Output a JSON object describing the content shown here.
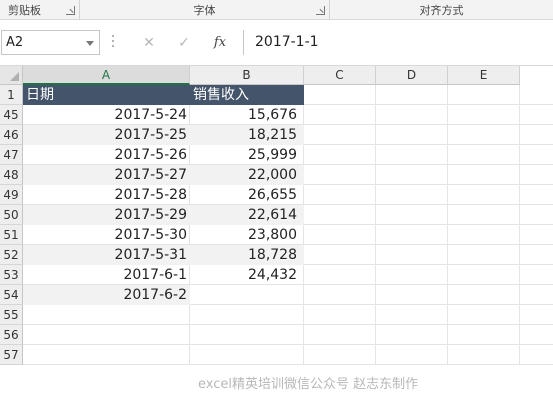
{
  "ribbon": {
    "groups": [
      {
        "label": "剪贴板"
      },
      {
        "label": "字体"
      },
      {
        "label": "对齐方式"
      }
    ]
  },
  "formula_bar": {
    "name_box": "A2",
    "cancel_glyph": "✕",
    "enter_glyph": "✓",
    "fx_label": "fx",
    "value": "2017-1-1"
  },
  "sheet": {
    "columns": [
      "A",
      "B",
      "C",
      "D",
      "E"
    ],
    "header_row": {
      "row": "1",
      "a": "日期",
      "b": "销售收入"
    },
    "rows": [
      {
        "row": "45",
        "a": "2017-5-24",
        "b": "15,676"
      },
      {
        "row": "46",
        "a": "2017-5-25",
        "b": "18,215"
      },
      {
        "row": "47",
        "a": "2017-5-26",
        "b": "25,999"
      },
      {
        "row": "48",
        "a": "2017-5-27",
        "b": "22,000"
      },
      {
        "row": "49",
        "a": "2017-5-28",
        "b": "26,655"
      },
      {
        "row": "50",
        "a": "2017-5-29",
        "b": "22,614"
      },
      {
        "row": "51",
        "a": "2017-5-30",
        "b": "23,800"
      },
      {
        "row": "52",
        "a": "2017-5-31",
        "b": "18,728"
      },
      {
        "row": "53",
        "a": "2017-6-1",
        "b": "24,432"
      },
      {
        "row": "54",
        "a": "2017-6-2",
        "b": ""
      },
      {
        "row": "55",
        "a": "",
        "b": ""
      },
      {
        "row": "56",
        "a": "",
        "b": ""
      },
      {
        "row": "57",
        "a": "",
        "b": ""
      }
    ]
  },
  "watermark": "excel精英培训微信公众号 赵志东制作",
  "colors": {
    "header_fill": "#44546a",
    "accent": "#217346",
    "band": "#f2f2f2"
  }
}
